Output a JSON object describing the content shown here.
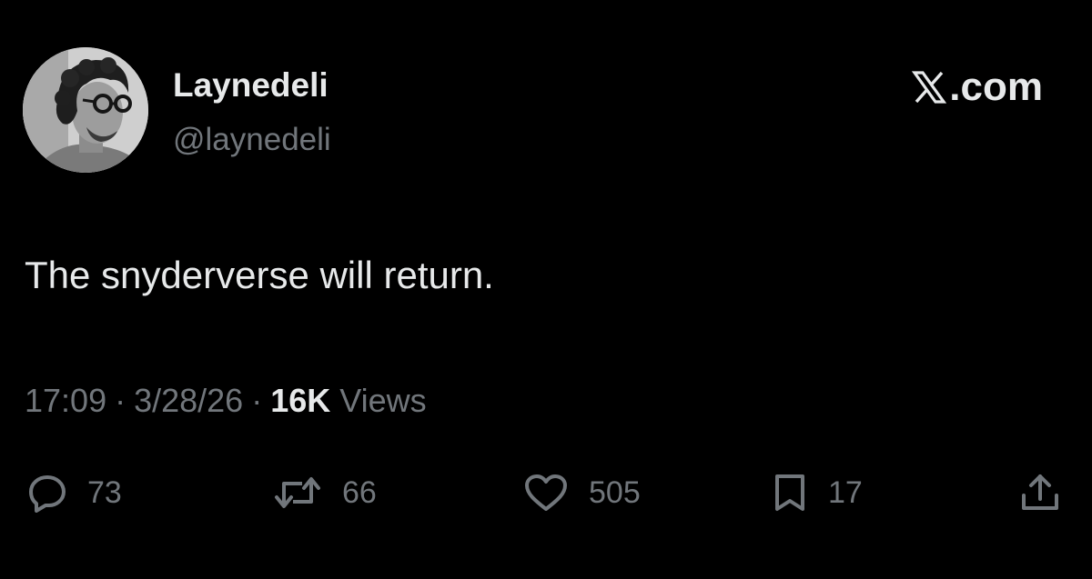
{
  "header": {
    "display_name": "Laynedeli",
    "handle": "@laynedeli",
    "brand": ".com",
    "brand_icon": "x-logo-icon"
  },
  "tweet": {
    "text": "The snyderverse will return.",
    "time": "17:09",
    "date": "3/28/26",
    "separator": "·",
    "views_count": "16K",
    "views_label": "Views"
  },
  "actions": {
    "replies": "73",
    "reposts": "66",
    "likes": "505",
    "bookmarks": "17"
  },
  "colors": {
    "background": "#000000",
    "primary_text": "#e7e9ea",
    "secondary_text": "#71767b"
  }
}
